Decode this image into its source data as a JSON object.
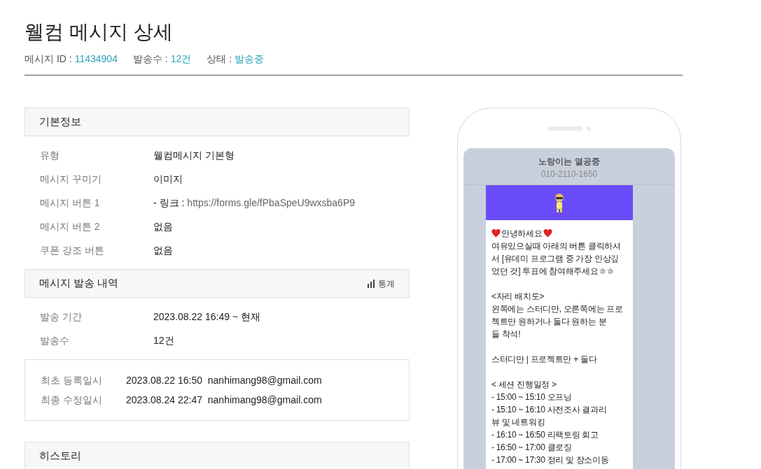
{
  "title": "웰컴 메시지 상세",
  "meta": [
    {
      "label": "메시지 ID :",
      "value": "11434904"
    },
    {
      "label": "발송수 :",
      "value": "12건"
    },
    {
      "label": "상태 :",
      "value": "발송중"
    }
  ],
  "basic_info": {
    "title": "기본정보",
    "rows": [
      {
        "label": "유형",
        "value": "웰컴메시지 기본형"
      },
      {
        "label": "메시지 꾸미기",
        "value": "이미지"
      },
      {
        "label": "메시지 버튼 1",
        "value": "- 링크 :",
        "link": "https://forms.gle/fPbaSpeU9wxsba6P9"
      },
      {
        "label": "메시지 버튼 2",
        "value": "없음"
      },
      {
        "label": "쿠폰 강조 버튼",
        "value": "없음"
      }
    ]
  },
  "send_history": {
    "title": "메시지 발송 내역",
    "stats_button": "통계",
    "rows": [
      {
        "label": "발송 기간",
        "value": "2023.08.22 16:49 ~ 현재"
      },
      {
        "label": "발송수",
        "value": "12건"
      }
    ]
  },
  "audit": [
    {
      "label": "최초 등록일시",
      "value": "2023.08.22 16:50  nanhimang98@gmail.com"
    },
    {
      "label": "최종 수정일시",
      "value": "2023.08.24 22:47  nanhimang98@gmail.com"
    }
  ],
  "history": {
    "title": "히스토리"
  },
  "preview": {
    "sender": "노랑이는 열공중",
    "phone": "010-2110-1650",
    "paragraphs": [
      [
        {
          "kind": "hearts",
          "text": "안녕하세요"
        },
        {
          "kind": "text",
          "text": "여유있으실때 아래의 버튼 클릭하셔"
        },
        {
          "kind": "text",
          "text": "서 [유데미 프로그램 중 가장 인상깊"
        },
        {
          "kind": "text",
          "text": "었던 것] 투표에 참여해주세요ㅎㅎ"
        }
      ],
      [
        {
          "kind": "text",
          "text": "<자리 배치도>"
        },
        {
          "kind": "text",
          "text": "왼쪽에는 스터디만, 오른쪽에는 프로"
        },
        {
          "kind": "text",
          "text": "젝트만 원하거나 둘다 원하는 분"
        },
        {
          "kind": "text",
          "text": "들 착석!"
        }
      ],
      [
        {
          "kind": "text",
          "text": "스터디만 | 프로젝트만 + 둘다"
        }
      ],
      [
        {
          "kind": "text",
          "text": "< 세션 진행일정 >"
        },
        {
          "kind": "text",
          "text": "- 15:00 ~ 15:10 오프닝"
        },
        {
          "kind": "text",
          "text": "- 15:10 ~ 16:10 사전조사 결과리"
        },
        {
          "kind": "text",
          "text": "뷰 및 네트워킹"
        },
        {
          "kind": "text",
          "text": "- 16:10 ~ 16:50 리팩토링 회고"
        },
        {
          "kind": "text",
          "text": "- 16:50 ~ 17:00 클로징"
        },
        {
          "kind": "text",
          "text": "- 17:00 ~ 17:30 정리 및 장소이동"
        }
      ]
    ]
  }
}
